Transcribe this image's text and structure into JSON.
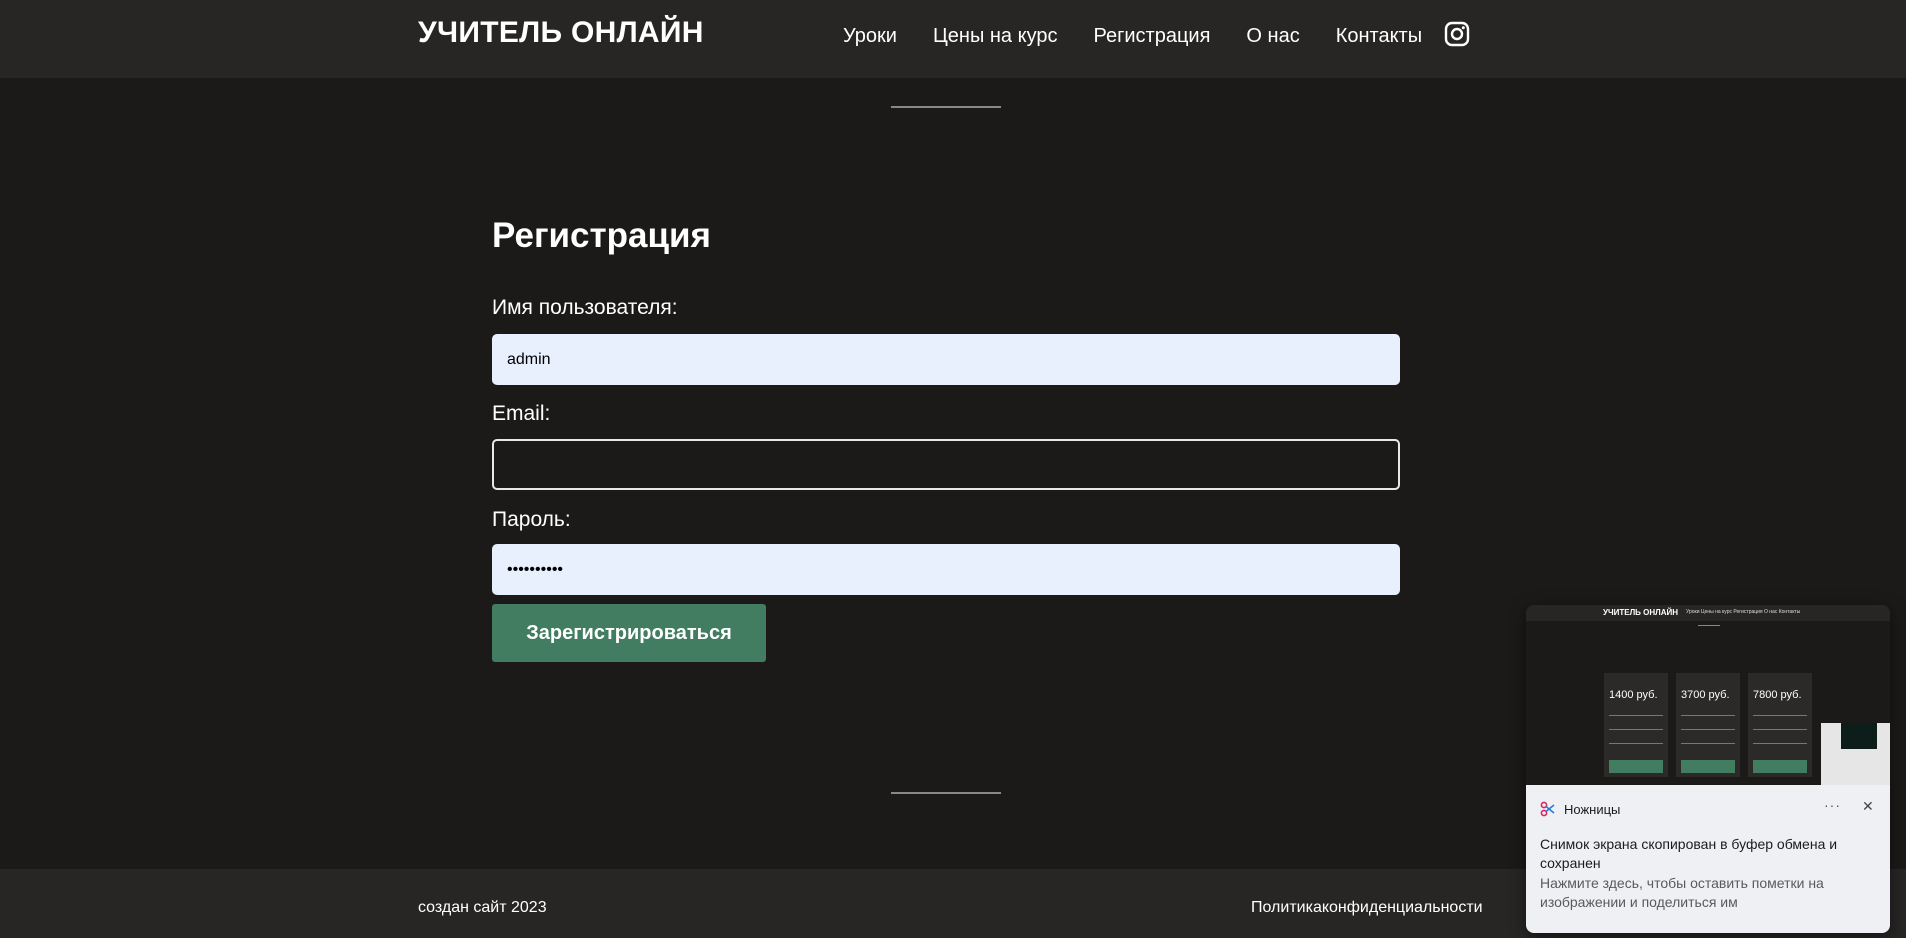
{
  "header": {
    "logo": "УЧИТЕЛЬ ОНЛАЙН",
    "nav": [
      "Уроки",
      "Цены на курс",
      "Регистрация",
      "О нас",
      "Контакты"
    ],
    "social_icon": "instagram-icon"
  },
  "form": {
    "title": "Регистрация",
    "username_label": "Имя пользователя:",
    "username_value": "admin",
    "email_label": "Email:",
    "email_value": "",
    "password_label": "Пароль:",
    "password_value": "••••••••••",
    "submit_label": "Зарегистрироваться"
  },
  "footer": {
    "left": "создан сайт 2023",
    "right": "Политикаконфиденциальности"
  },
  "notification": {
    "app_name": "Ножницы",
    "more": "···",
    "close": "✕",
    "message": "Снимок экрана скопирован в буфер обмена и сохранен",
    "secondary": "Нажмите здесь, чтобы оставить пометки на изображении и поделиться им",
    "preview": {
      "logo": "УЧИТЕЛЬ ОНЛАЙН",
      "nav": "Уроки   Цены на курс   Регистрация   О нас   Контакты",
      "cards": [
        {
          "price": "1400 руб."
        },
        {
          "price": "3700 руб."
        },
        {
          "price": "7800 руб."
        }
      ]
    }
  },
  "colors": {
    "background": "#1c1a19",
    "header": "#272625",
    "button": "#427c61",
    "autofill": "#e8f0fe"
  }
}
